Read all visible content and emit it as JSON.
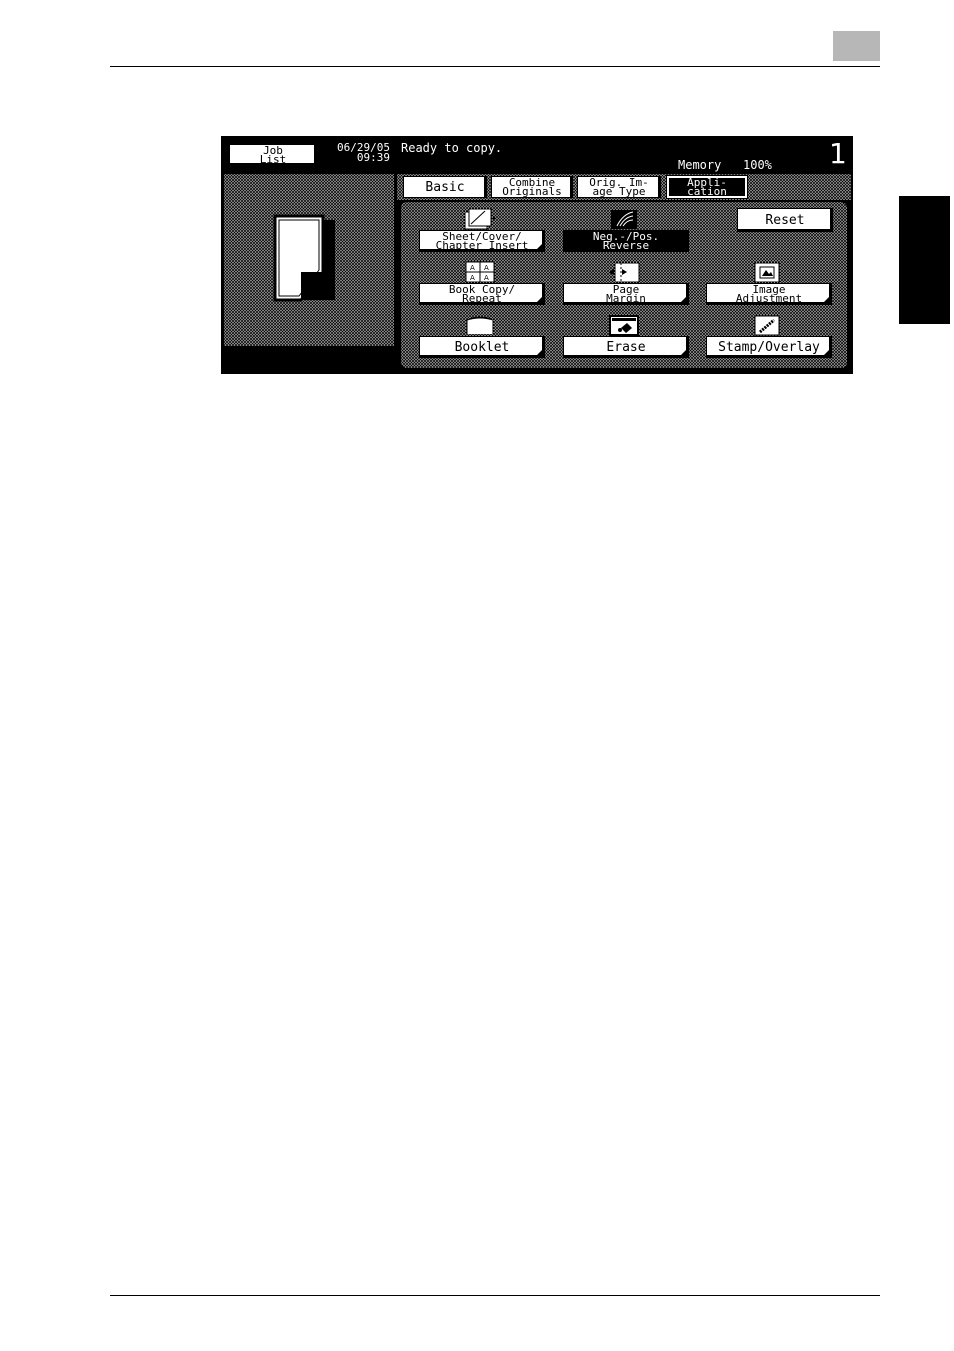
{
  "job_list_button": {
    "label_line1": "Job",
    "label_line2": "List"
  },
  "datetime": {
    "date": "06/29/05",
    "time": "09:39"
  },
  "status": {
    "message": "Ready to copy.",
    "memory_label": "Memory",
    "memory_value": "100%",
    "copies": "1"
  },
  "tabs": [
    {
      "line1": "Basic",
      "line2": "",
      "active": false
    },
    {
      "line1": "Combine",
      "line2": "Originals",
      "active": false
    },
    {
      "line1": "Orig. Im-",
      "line2": "age Type",
      "active": false
    },
    {
      "line1": "Appli-",
      "line2": "cation",
      "active": true
    }
  ],
  "reset_button": {
    "label": "Reset"
  },
  "functions": {
    "sheet_cover": {
      "line1": "Sheet/Cover/",
      "line2": "Chapter Insert",
      "icon": "sheet-insert-icon"
    },
    "neg_pos": {
      "line1": "Neg.-/Pos.",
      "line2": "Reverse",
      "icon": "neg-pos-icon"
    },
    "book_copy": {
      "line1": "Book Copy/",
      "line2": "Repeat",
      "icon": "book-copy-icon"
    },
    "page_margin": {
      "line1": "Page",
      "line2": "Margin",
      "icon": "page-margin-icon"
    },
    "image_adjustment": {
      "line1": "Image",
      "line2": "Adjustment",
      "icon": "image-adjust-icon"
    },
    "booklet": {
      "line1": "Booklet",
      "icon": "booklet-icon"
    },
    "erase": {
      "line1": "Erase",
      "icon": "erase-icon"
    },
    "stamp_overlay": {
      "line1": "Stamp/Overlay",
      "icon": "stamp-icon"
    }
  }
}
